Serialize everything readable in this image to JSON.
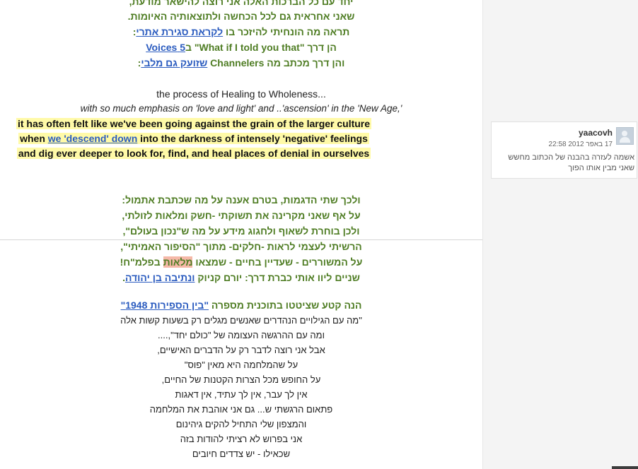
{
  "post": {
    "lines": [
      {
        "text": "יחד עם כל הברכות האלה אני רוצה להישאר מודעת,"
      },
      {
        "text": "שאני אחראית גם לכל הכחשה ולתוצאותיה האיומות."
      },
      {
        "pre": "תראה מה הונחיתי להיזכר בו ",
        "link": "לקראת סגירת אתרי",
        "post": ":"
      },
      {
        "pre": "הן דרך \"What if I told you that\" ב",
        "link": "5 Voices"
      },
      {
        "pre": "והן דרך מכתב מה Channelers ",
        "link": "שזועק גם מלבי",
        "post": ":"
      },
      {
        "text": "the process of Healing to Wholeness..."
      },
      {
        "text": "with so much emphasis on 'love and light' and ..'ascension' in the 'New Age,'"
      },
      {
        "text": "it has often felt like we've been going against the grain of the larger culture"
      },
      {
        "pre": "when ",
        "link": "we 'descend' down",
        "post": " into the darkness of intensely 'negative' feelings"
      },
      {
        "text": "and dig ever deeper to look for, find, and heal places of denial in ourselves"
      },
      {
        "text": "ולכך שתי הדגמות, בטרם אענה על מה שכתבת אתמול:"
      },
      {
        "text": "על אף שאני מקרינה את תשוקתי -חשק ומלאות לזולתי,"
      },
      {
        "text": "ולכן בוחרת לשאוף ולחגוג  מידע על מה ש\"נכון בעולם\","
      },
      {
        "text": "הרשיתי לעצמי לראות -חלקים- מתוך \"הסיפור האמיתי\","
      },
      {
        "pre": "על המשוררים - שעדיין בחיים - שמצאו ",
        "mark": "מלאות",
        "post": " בפלמ\"ח!"
      },
      {
        "pre": "שניים ליוו אותי כברת דרך: יורם ",
        "sp1": "קניוק",
        "mid": " ",
        "link": "ונתיבה בן יהודה",
        "post": "."
      },
      {
        "pre": "הנה קטע שציטטו ",
        "sp1": "בתוכנית",
        "mid": " מספרה ",
        "link": "\"בין הספירות 1948\""
      },
      {
        "text": "\"מה עם הגילויים הנהדרים שאנשים מגלים רק בשעות קשות אלה"
      },
      {
        "text": "ומה עם ההרגשה העצומה של \"כולם יחד\",...."
      },
      {
        "text": "אבל אני רוצה לדבר רק על הדברים האישיים,"
      },
      {
        "text": "על שהמלחמה היא מאין \"פוס\""
      },
      {
        "text": "על החופש מכל הצרות הקטנות של החיים,"
      },
      {
        "text": "אין לך עבר, אין לך עתיד, אין דאגות"
      },
      {
        "text": "פתאום הרגשתי ש... גם אני אוהבת את המלחמה"
      },
      {
        "text": "והמצפון שלי התחיל להקים גיהינום"
      },
      {
        "text": "אני בפרוש לא רציתי להודות בזה"
      },
      {
        "text": "שכאילו - יש צדדים חיובים"
      }
    ]
  },
  "comment": {
    "username": "yaacovh",
    "timestamp": "17 באפר 2012 22:58",
    "text": "אשמה לעזרה בהבנה של הכתוב מחשש שאני מבין אותו הפוך"
  }
}
